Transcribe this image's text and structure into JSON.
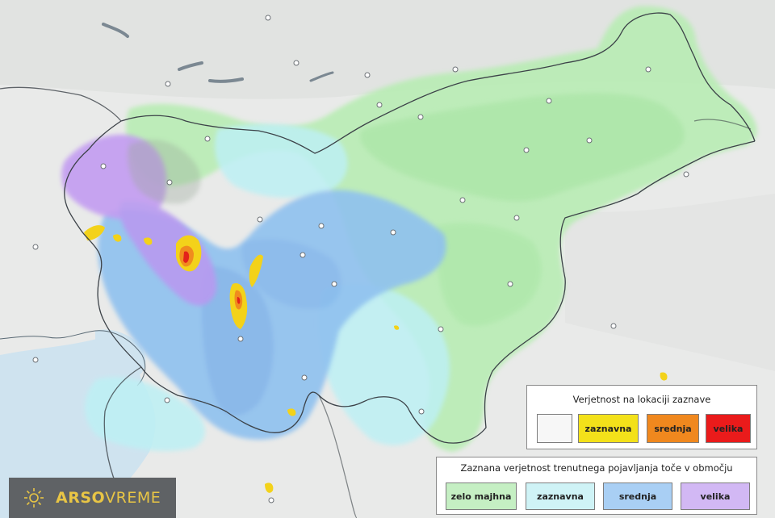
{
  "legend_location": {
    "title": "Verjetnost na lokaciji zaznave",
    "items": [
      {
        "label": "",
        "color": "#f7f7f7"
      },
      {
        "label": "zaznavna",
        "color": "#f3e11a"
      },
      {
        "label": "srednja",
        "color": "#f0881e"
      },
      {
        "label": "velika",
        "color": "#ea1b1b"
      }
    ]
  },
  "legend_area": {
    "title": "Zaznana verjetnost trenutnega pojavljanja toče v območju",
    "items": [
      {
        "label": "zelo majhna",
        "color": "#c5efc3"
      },
      {
        "label": "zaznavna",
        "color": "#cff3f6"
      },
      {
        "label": "srednja",
        "color": "#a9cff4"
      },
      {
        "label": "velika",
        "color": "#d2b8f4"
      }
    ]
  },
  "logo": {
    "part1": "ARSO",
    "part2": "VREME",
    "icon": "sun-icon",
    "color": "#e8c545"
  },
  "colors": {
    "land_outside": "#e6e7e6",
    "sea": "#cfe6f5",
    "zone_green": "#b6edb1",
    "zone_cyan": "#bdf0f4",
    "zone_blue": "#8fc1ef",
    "zone_purple": "#c39cf1",
    "hail_yellow": "#f3d21a",
    "hail_orange": "#f08c1e",
    "hail_red": "#e3221a"
  }
}
